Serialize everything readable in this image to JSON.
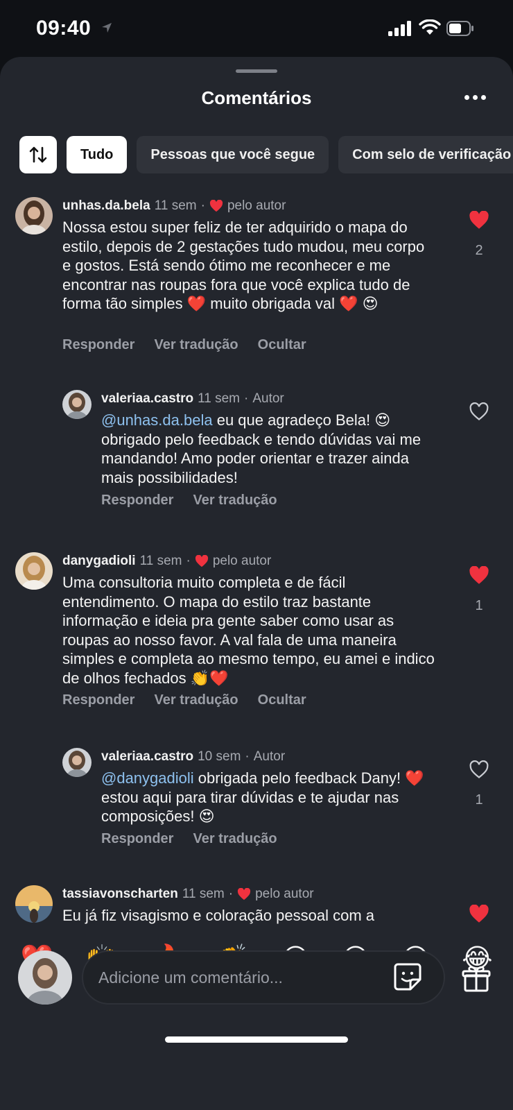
{
  "status_bar": {
    "time": "09:40",
    "icons": [
      "location-arrow-icon",
      "signal-icon",
      "wifi-icon",
      "battery-icon"
    ]
  },
  "sheet": {
    "title": "Comentários",
    "more_icon": "more-icon"
  },
  "filters": {
    "sort_icon": "sort-icon",
    "chips": [
      "Tudo",
      "Pessoas que você segue",
      "Com selo de verificação"
    ]
  },
  "colors": {
    "heart": "#f0323f",
    "mention": "#8ec1ef",
    "sheet_bg": "#23262d"
  },
  "comments": [
    {
      "user": "unhas.da.bela",
      "time": "11 sem",
      "liked_by_author": "pelo autor",
      "text": "Nossa estou super feliz de ter adquirido o mapa do estilo, depois de 2 gestações tudo mudou, meu corpo e gostos. Está sendo ótimo me reconhecer e me encontrar nas roupas fora que você explica tudo de forma tão simples ❤️ muito obrigada val ❤️ 😍",
      "actions": [
        "Responder",
        "Ver tradução",
        "Ocultar"
      ],
      "liked": true,
      "likes": "2"
    },
    {
      "user": "valeriaa.castro",
      "time": "11 sem",
      "badge": "Autor",
      "mention": "@unhas.da.bela",
      "text": "eu que agradeço Bela! 😍 obrigado pelo feedback e tendo dúvidas vai me mandando! Amo poder orientar e trazer ainda mais possibilidades!",
      "actions": [
        "Responder",
        "Ver tradução"
      ],
      "liked": false
    },
    {
      "user": "danygadioli",
      "time": "11 sem",
      "liked_by_author": "pelo autor",
      "text": "Uma consultoria muito completa e de fácil entendimento. O mapa do estilo traz bastante informação e ideia pra gente saber como usar as roupas ao nosso favor. A val fala de uma maneira simples e completa ao mesmo tempo, eu amei e indico de olhos fechados 👏❤️",
      "actions": [
        "Responder",
        "Ver tradução",
        "Ocultar"
      ],
      "liked": true,
      "likes": "1"
    },
    {
      "user": "valeriaa.castro",
      "time": "10 sem",
      "badge": "Autor",
      "mention": "@danygadioli",
      "text": "obrigada pelo feedback Dany! ❤️ estou aqui para tirar dúvidas e te ajudar nas composições! 😍",
      "actions": [
        "Responder",
        "Ver tradução"
      ],
      "liked": false,
      "likes": "1"
    },
    {
      "user": "tassiavonscharten",
      "time": "11 sem",
      "liked_by_author": "pelo autor",
      "text": "Eu já fiz visagismo e coloração pessoal com a",
      "liked": true
    }
  ],
  "emoji_bar": [
    "❤️",
    "🙌",
    "🔥",
    "👏",
    "😢",
    "😍",
    "😮",
    "😂"
  ],
  "composer": {
    "placeholder": "Adicione um comentário...",
    "sticker_icon": "sticker-icon",
    "gift_icon": "gift-icon"
  }
}
